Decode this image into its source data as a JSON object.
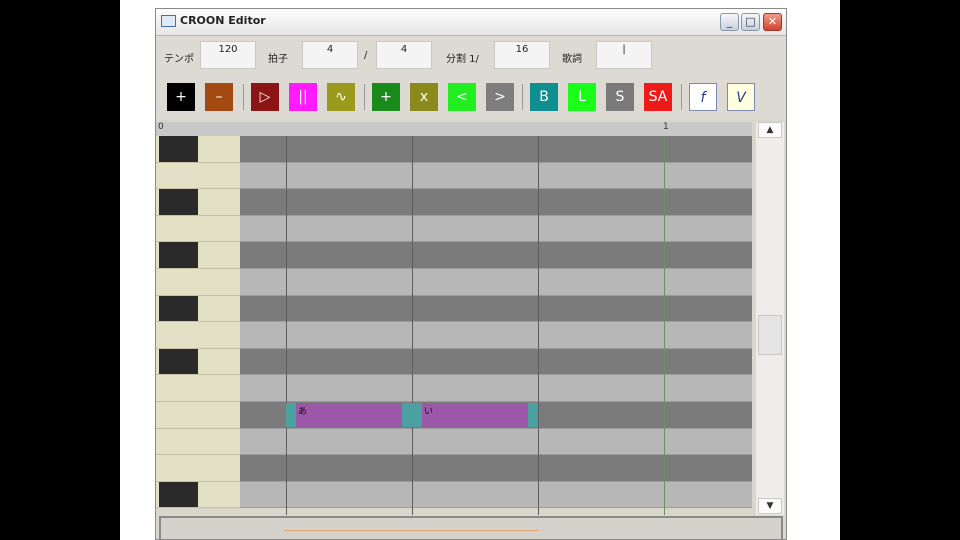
{
  "window": {
    "title": "CROON Editor"
  },
  "settings": {
    "tempo_label": "テンポ",
    "tempo_value": "120",
    "beat_label": "拍子",
    "beat_numerator": "4",
    "beat_slash": "/",
    "beat_denominator": "4",
    "division_label": "分割 1/",
    "division_value": "16",
    "lyric_label": "歌詞",
    "lyric_value": "|"
  },
  "toolbar": {
    "tools": [
      {
        "symbol": "+",
        "color": "#000000"
      },
      {
        "symbol": "–",
        "color": "#a34a12"
      },
      {
        "symbol": "▷",
        "color": "#8b1414"
      },
      {
        "symbol": "||",
        "color": "#ff1aff"
      },
      {
        "symbol": "∿",
        "color": "#9c9a1c"
      },
      {
        "symbol": "+",
        "color": "#1a8a1a"
      },
      {
        "symbol": "x",
        "color": "#8a8a1c"
      },
      {
        "symbol": "<",
        "color": "#22ee22"
      },
      {
        "symbol": ">",
        "color": "#7d7d7d"
      },
      {
        "symbol": "B",
        "color": "#0f8f8f"
      },
      {
        "symbol": "L",
        "color": "#1aff1a"
      },
      {
        "symbol": "S",
        "color": "#7a7a7a"
      },
      {
        "symbol": "SA",
        "color": "#ee1a1a"
      },
      {
        "symbol": "f",
        "color": "#ffffff"
      },
      {
        "symbol": "V",
        "color": "#ffffe0"
      }
    ]
  },
  "ruler": {
    "start_mark": "0",
    "end_mark": "1"
  },
  "notes": [
    {
      "lyric": "あ",
      "start_beat": 0,
      "length_beats": 1
    },
    {
      "lyric": "い",
      "start_beat": 1,
      "length_beats": 1
    }
  ],
  "scrollbar": {
    "up": "▲",
    "down": "▼",
    "grip": "≡"
  }
}
